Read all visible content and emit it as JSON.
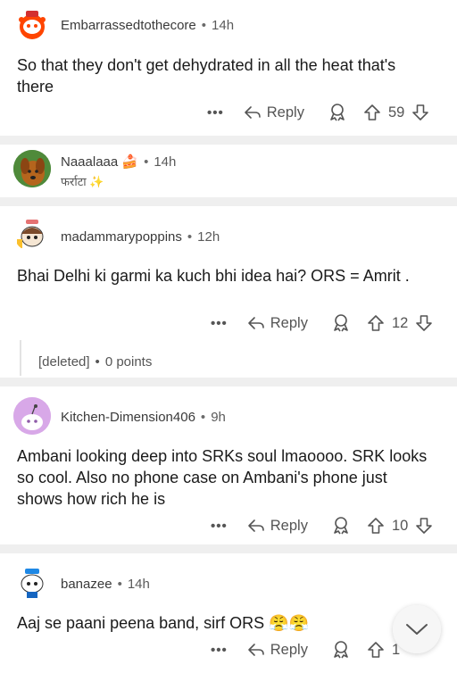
{
  "comments": [
    {
      "username": "Embarrassedtothecore",
      "time": "14h",
      "text": "So that they don't get dehydrated in all the heat that's there",
      "reply_label": "Reply",
      "score": "59"
    },
    {
      "username": "Naaalaaa",
      "time": "14h",
      "flair": "फर्राटा"
    },
    {
      "username": "madammarypoppins",
      "time": "12h",
      "text": "Bhai Delhi ki garmi ka kuch bhi idea hai? ORS = Amrit .",
      "reply_label": "Reply",
      "score": "12",
      "child": {
        "author": "[deleted]",
        "points": "0 points"
      }
    },
    {
      "username": "Kitchen-Dimension406",
      "time": "9h",
      "text": "Ambani looking deep into SRKs soul lmaoooo. SRK looks so cool. Also no phone case on Ambani's phone just shows how rich he is",
      "reply_label": "Reply",
      "score": "10"
    },
    {
      "username": "banazee",
      "time": "14h",
      "text": "Aaj se paani peena band, sirf ORS",
      "emoji": "😤😤",
      "reply_label": "Reply",
      "score": "1"
    }
  ],
  "icons": {
    "more": "more-options-icon",
    "reply": "reply-arrow-icon",
    "award": "award-icon",
    "upvote": "upvote-arrow-icon",
    "downvote": "downvote-arrow-icon",
    "scroll": "chevron-down-icon"
  },
  "colors": {
    "separator": "#efefef",
    "meta": "#555555"
  }
}
